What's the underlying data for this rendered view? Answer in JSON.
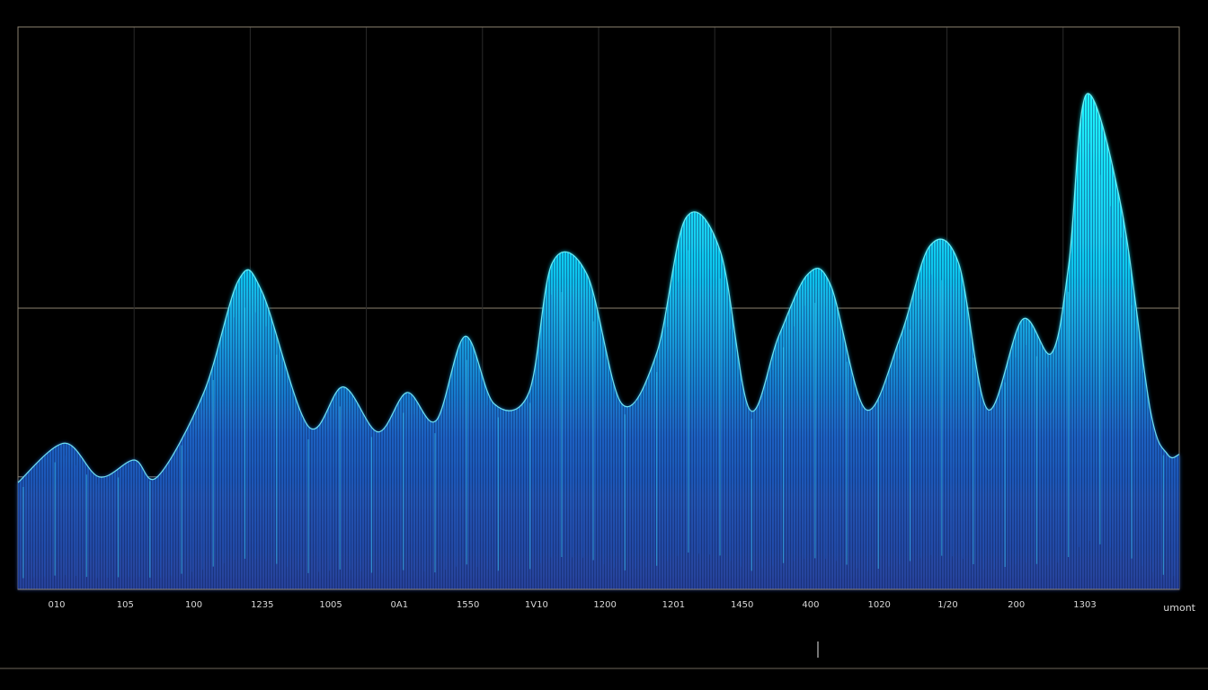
{
  "colors": {
    "background": "#000000",
    "frame": "#8c8270",
    "grid_vertical": "#2a2a2a",
    "wave_glow": "#1ff4ff",
    "wave_body": "#0a7fd8",
    "wave_floor": "#27419a"
  },
  "chart_data": {
    "type": "area",
    "title": "",
    "xlabel": "",
    "ylabel": "",
    "unit_label": "umont",
    "grid": true,
    "legend": "none",
    "x_tick_labels": [
      "010",
      "105",
      "100",
      "1235",
      "1005",
      "0A1",
      "1550",
      "1V10",
      "1200",
      "1201",
      "1450",
      "400",
      "1020",
      "1/20",
      "200",
      "1303"
    ],
    "horizontal_reference_levels": [
      0.2,
      0.5
    ],
    "xlim": [
      0,
      1
    ],
    "ylim": [
      0,
      1
    ],
    "series": [
      {
        "x": [
          0.0,
          0.04,
          0.07,
          0.1,
          0.12,
          0.16,
          0.19,
          0.21,
          0.25,
          0.28,
          0.31,
          0.335,
          0.36,
          0.385,
          0.41,
          0.44,
          0.46,
          0.49,
          0.52,
          0.55,
          0.575,
          0.605,
          0.63,
          0.655,
          0.68,
          0.7,
          0.73,
          0.76,
          0.785,
          0.81,
          0.835,
          0.865,
          0.89,
          0.905,
          0.92,
          0.95,
          0.975,
          0.99,
          1.0
        ],
        "values": [
          0.19,
          0.26,
          0.2,
          0.23,
          0.2,
          0.35,
          0.55,
          0.53,
          0.29,
          0.36,
          0.28,
          0.35,
          0.3,
          0.45,
          0.33,
          0.35,
          0.58,
          0.56,
          0.33,
          0.42,
          0.66,
          0.6,
          0.32,
          0.45,
          0.56,
          0.54,
          0.32,
          0.45,
          0.61,
          0.58,
          0.32,
          0.48,
          0.42,
          0.58,
          0.88,
          0.68,
          0.32,
          0.24,
          0.24
        ]
      }
    ]
  }
}
